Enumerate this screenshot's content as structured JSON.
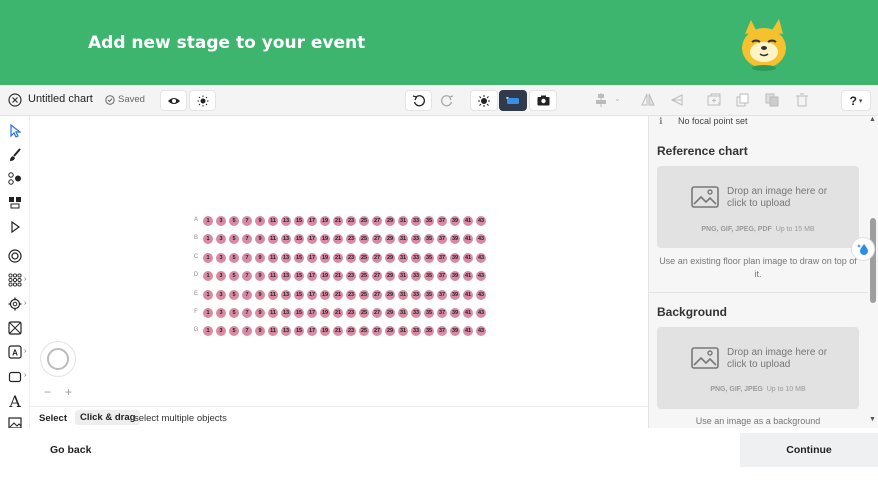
{
  "banner": {
    "title": "Add new stage to your event"
  },
  "toolbar": {
    "chart_name": "Untitled chart",
    "saved_status": "Saved",
    "help_label": "?"
  },
  "panel": {
    "focal_point_text": "No focal point set",
    "reference": {
      "title": "Reference chart",
      "drop_text": "Drop an image here or click to upload",
      "formats": "PNG, GIF, JPEG, PDF",
      "limit": "Up to 15 MB",
      "help": "Use an existing floor plan image to draw on top of it."
    },
    "background": {
      "title": "Background",
      "drop_text": "Drop an image here or click to upload",
      "formats": "PNG, GIF, JPEG",
      "limit": "Up to 10 MB",
      "help": "Use an image as a background"
    }
  },
  "statusbar": {
    "mode": "Select",
    "key": "Click & drag",
    "description": "select multiple objects"
  },
  "footer": {
    "back_label": "Go back",
    "continue_label": "Continue"
  },
  "seating": {
    "rows": [
      "A",
      "B",
      "C",
      "D",
      "E",
      "F",
      "G"
    ],
    "seat_numbers": [
      "1",
      "3",
      "5",
      "7",
      "9",
      "11",
      "13",
      "15",
      "17",
      "19",
      "21",
      "23",
      "25",
      "27",
      "29",
      "31",
      "33",
      "35",
      "37",
      "39",
      "41",
      "43"
    ]
  },
  "colors": {
    "brand_green": "#3db56e",
    "seat_pink": "#d98aa3",
    "mascot_yellow": "#f5c12e"
  },
  "icons": {
    "close": "close-circle-icon",
    "saved": "check-circle-icon",
    "view": "eye-icon",
    "theme": "sun-icon",
    "undo": "undo-icon",
    "redo": "redo-icon",
    "focus": "target-icon",
    "selection": "selection-mode-icon",
    "snapshot": "camera-icon"
  }
}
